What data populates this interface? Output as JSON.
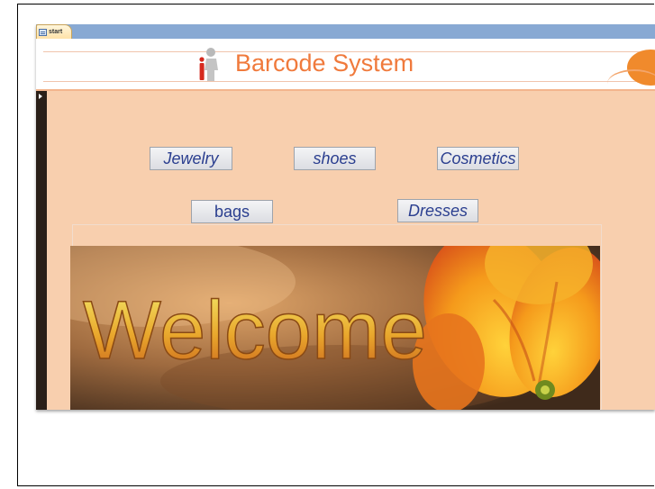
{
  "tab": {
    "label": "start",
    "icon": "form-icon"
  },
  "header": {
    "title": "Barcode System",
    "icon": "person-info-icon"
  },
  "buttons": [
    {
      "label": "Jewelry",
      "italic": true
    },
    {
      "label": "shoes",
      "italic": true
    },
    {
      "label": "Cosmetics",
      "italic": true
    },
    {
      "label": "bags",
      "italic": false
    },
    {
      "label": "Dresses",
      "italic": true
    }
  ],
  "welcome_image": {
    "text": "Welcome"
  },
  "colors": {
    "tab_bar": "#88a9d3",
    "background": "#f8cfae",
    "title": "#f07a3c",
    "button_text": "#2a3e8f"
  }
}
